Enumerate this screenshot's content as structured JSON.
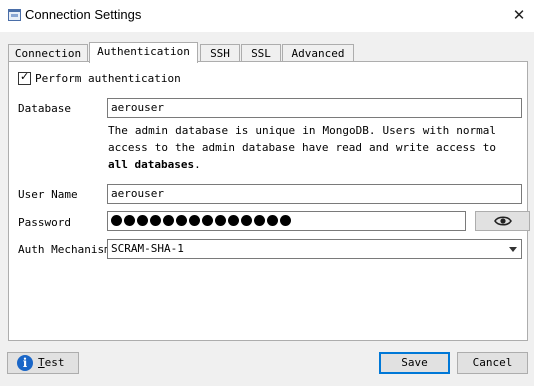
{
  "window": {
    "title": "Connection Settings",
    "close_glyph": "✕"
  },
  "tabs": [
    {
      "label": "Connection",
      "active": false
    },
    {
      "label": "Authentication",
      "active": true
    },
    {
      "label": "SSH",
      "active": false
    },
    {
      "label": "SSL",
      "active": false
    },
    {
      "label": "Advanced",
      "active": false
    }
  ],
  "auth": {
    "perform_auth_label": "Perform authentication",
    "perform_auth_checked": true,
    "database_label": "Database",
    "database_value": "aerouser",
    "description_part1": "The admin database is unique in MongoDB. Users with normal access to the admin database have read and write access to ",
    "description_bold": "all databases",
    "description_end": ".",
    "username_label": "User Name",
    "username_value": "aerouser",
    "password_label": "Password",
    "password_masked_length": 14,
    "password_toggle_icon": "eye-icon",
    "mechanism_label": "Auth Mechanism",
    "mechanism_value": "SCRAM-SHA-1"
  },
  "buttons": {
    "test_prefix": "T",
    "test_rest": "est",
    "save_label": "Save",
    "cancel_label": "Cancel"
  },
  "colors": {
    "accent": "#0078d7",
    "info_icon": "#1a66c7"
  }
}
